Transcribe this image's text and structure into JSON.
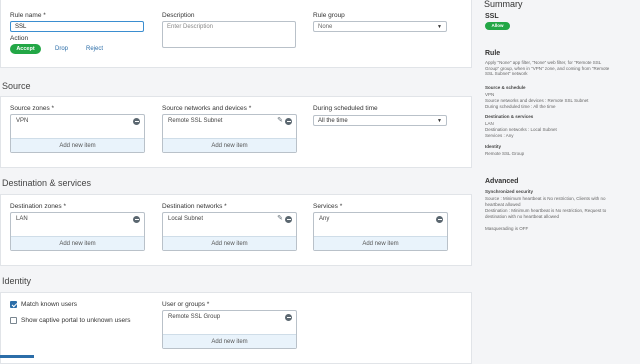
{
  "rule": {
    "name_label": "Rule name *",
    "name_value": "SSL",
    "description_label": "Description",
    "description_placeholder": "Enter Description",
    "group_label": "Rule group",
    "group_value": "None",
    "action_label": "Action",
    "actions": [
      "Accept",
      "Drop",
      "Reject"
    ]
  },
  "source": {
    "title": "Source",
    "zones_label": "Source zones *",
    "zones_item": "VPN",
    "networks_label": "Source networks and devices *",
    "networks_item": "Remote SSL Subnet",
    "schedule_label": "During scheduled time",
    "schedule_value": "All the time",
    "add_new": "Add new item"
  },
  "destination": {
    "title": "Destination & services",
    "zones_label": "Destination zones *",
    "zones_item": "LAN",
    "networks_label": "Destination networks *",
    "networks_item": "Local Subnet",
    "services_label": "Services *",
    "services_item": "Any",
    "add_new": "Add new item"
  },
  "identity": {
    "title": "Identity",
    "match_known_users": "Match known users",
    "show_captive_portal": "Show captive portal to unknown users",
    "users_label": "User or groups *",
    "users_item": "Remote SSL Group",
    "add_new": "Add new item"
  },
  "summary": {
    "title": "Summary",
    "rule_name": "SSL",
    "badge": "Allow",
    "rule_heading": "Rule",
    "rule_text": "Apply \"None\" app filter, \"None\" web filter, for \"Remote SSL Group\" group, when in \"VPN\" zone, and coming from \"Remote SSL Subnet\" network",
    "source_heading": "Source & schedule",
    "source_lines": [
      "VPN",
      "Source networks and devices : Remote SSL Subnet",
      "During scheduled time : All the time"
    ],
    "dest_heading": "Destination & services",
    "dest_lines": [
      "LAN",
      "Destination networks : Local Subnet",
      "Services : Any"
    ],
    "identity_heading": "Identity",
    "identity_lines": [
      "Remote SSL Group"
    ],
    "advanced_heading": "Advanced",
    "sync_heading": "Synchronized security",
    "sync_lines": [
      "Source : Minimum heartbeat is No restriction, Clients with no heartbeat allowed",
      "Destination : Minimum heartbeat is No restriction, Request to destination with no heartbeat allowed"
    ],
    "masq_line": "Masquerading is OFF"
  },
  "colors": {
    "accent_green": "#23a746",
    "link_blue": "#2b6da8",
    "add_row_bg": "#e9f3fb"
  }
}
